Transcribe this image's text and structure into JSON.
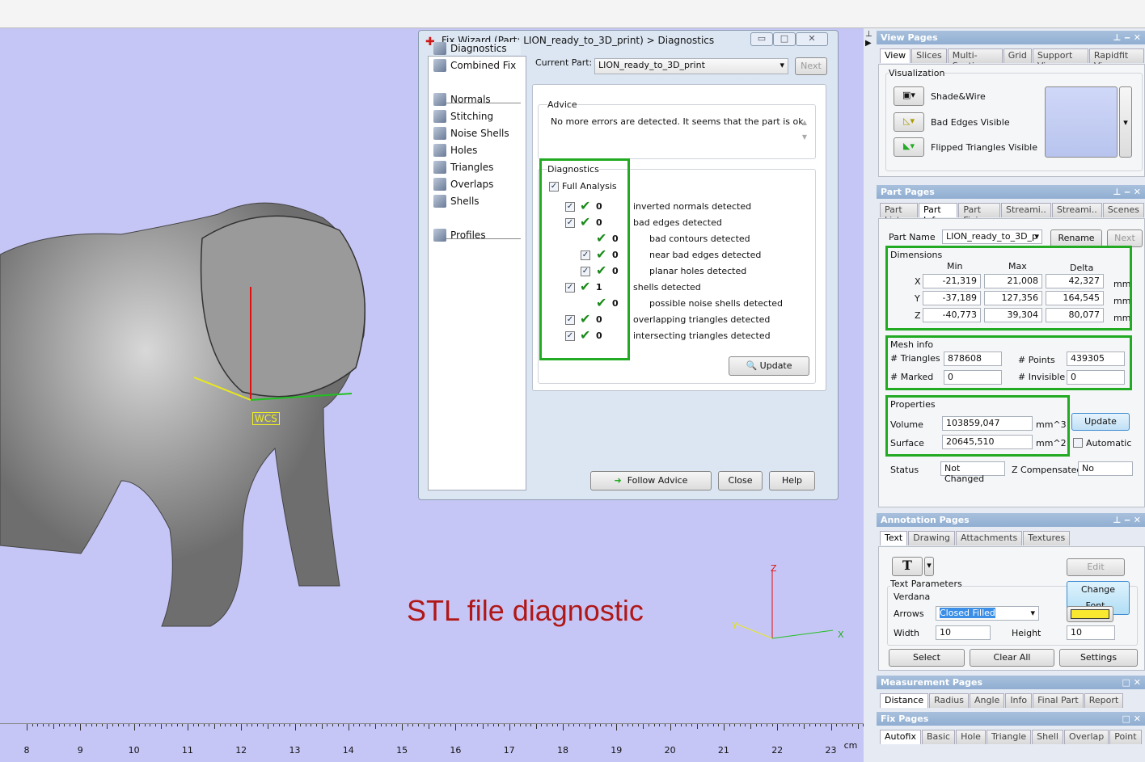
{
  "dialog": {
    "title": "Fix Wizard (Part: LION_ready_to_3D_print) > Diagnostics",
    "nav": [
      "Diagnostics",
      "Combined Fix",
      "Normals",
      "Stitching",
      "Noise Shells",
      "Holes",
      "Triangles",
      "Overlaps",
      "Shells",
      "Profiles"
    ],
    "current_part_label": "Current Part:",
    "current_part_value": "LION_ready_to_3D_print",
    "next_label": "Next",
    "advice_label": "Advice",
    "advice_text": "No more errors are detected. It seems that the part is ok.",
    "diagnostics_label": "Diagnostics",
    "full_analysis": "Full Analysis",
    "rows": [
      {
        "value": "0",
        "label": "inverted normals detected"
      },
      {
        "value": "0",
        "label": "bad edges detected"
      },
      {
        "value": "0",
        "label": "bad contours detected"
      },
      {
        "value": "0",
        "label": "near bad edges detected"
      },
      {
        "value": "0",
        "label": "planar holes detected"
      },
      {
        "value": "1",
        "label": "shells detected"
      },
      {
        "value": "0",
        "label": "possible noise shells detected"
      },
      {
        "value": "0",
        "label": "overlapping triangles detected"
      },
      {
        "value": "0",
        "label": "intersecting triangles detected"
      }
    ],
    "update_label": "Update",
    "follow_advice": "Follow Advice",
    "close": "Close",
    "help": "Help"
  },
  "viewport": {
    "caption": "STL file diagnostic",
    "wcs": "WCS",
    "axis_x": "X",
    "axis_y": "Y",
    "axis_z": "Z",
    "background": "#c6c6f6"
  },
  "ruler": {
    "ticks": [
      "8",
      "9",
      "10",
      "11",
      "12",
      "13",
      "14",
      "15",
      "16",
      "17",
      "18",
      "19",
      "20",
      "21",
      "22",
      "23"
    ],
    "unit": "cm"
  },
  "view_pages": {
    "title": "View Pages",
    "tabs": [
      "View",
      "Slices",
      "Multi-Section",
      "Grid",
      "Support View",
      "Rapidfit View"
    ],
    "visualization": "Visualization",
    "items": [
      "Shade&Wire",
      "Bad Edges Visible",
      "Flipped Triangles Visible"
    ]
  },
  "part_pages": {
    "title": "Part Pages",
    "tabs": [
      "Part List",
      "Part Info",
      "Part Fixi..",
      "Streami..",
      "Streami..",
      "Scenes"
    ],
    "part_name_label": "Part Name",
    "part_name": "LION_ready_to_3D_p",
    "rename": "Rename",
    "next": "Next",
    "dimensions": "Dimensions",
    "cols": [
      "Min",
      "Max",
      "Delta"
    ],
    "dims": [
      {
        "axis": "X",
        "min": "-21,319",
        "max": "21,008",
        "delta": "42,327",
        "unit": "mm"
      },
      {
        "axis": "Y",
        "min": "-37,189",
        "max": "127,356",
        "delta": "164,545",
        "unit": "mm"
      },
      {
        "axis": "Z",
        "min": "-40,773",
        "max": "39,304",
        "delta": "80,077",
        "unit": "mm"
      }
    ],
    "mesh_info": "Mesh info",
    "triangles_label": "# Triangles",
    "triangles": "878608",
    "points_label": "# Points",
    "points": "439305",
    "marked_label": "# Marked",
    "marked": "0",
    "invisible_label": "# Invisible",
    "invisible": "0",
    "properties": "Properties",
    "volume_label": "Volume",
    "volume": "103859,047",
    "volume_unit": "mm^3",
    "surface_label": "Surface",
    "surface": "20645,510",
    "surface_unit": "mm^2",
    "update": "Update",
    "automatic": "Automatic",
    "status_label": "Status",
    "status": "Not Changed",
    "zcomp_label": "Z Compensated",
    "zcomp": "No"
  },
  "annotation_pages": {
    "title": "Annotation Pages",
    "tabs": [
      "Text",
      "Drawing",
      "Attachments",
      "Textures"
    ],
    "edit": "Edit",
    "text_params": "Text Parameters",
    "font": "Verdana",
    "change_font": "Change Font..",
    "arrows_label": "Arrows",
    "arrows": "Closed Filled",
    "width_label": "Width",
    "width": "10",
    "height_label": "Height",
    "height": "10",
    "select": "Select",
    "clear_all": "Clear All",
    "settings": "Settings",
    "color": "#f8e830"
  },
  "measurement_pages": {
    "title": "Measurement Pages",
    "tabs": [
      "Distance",
      "Radius",
      "Angle",
      "Info",
      "Final Part",
      "Report"
    ]
  },
  "fix_pages": {
    "title": "Fix Pages",
    "tabs": [
      "Autofix",
      "Basic",
      "Hole",
      "Triangle",
      "Shell",
      "Overlap",
      "Point"
    ]
  }
}
